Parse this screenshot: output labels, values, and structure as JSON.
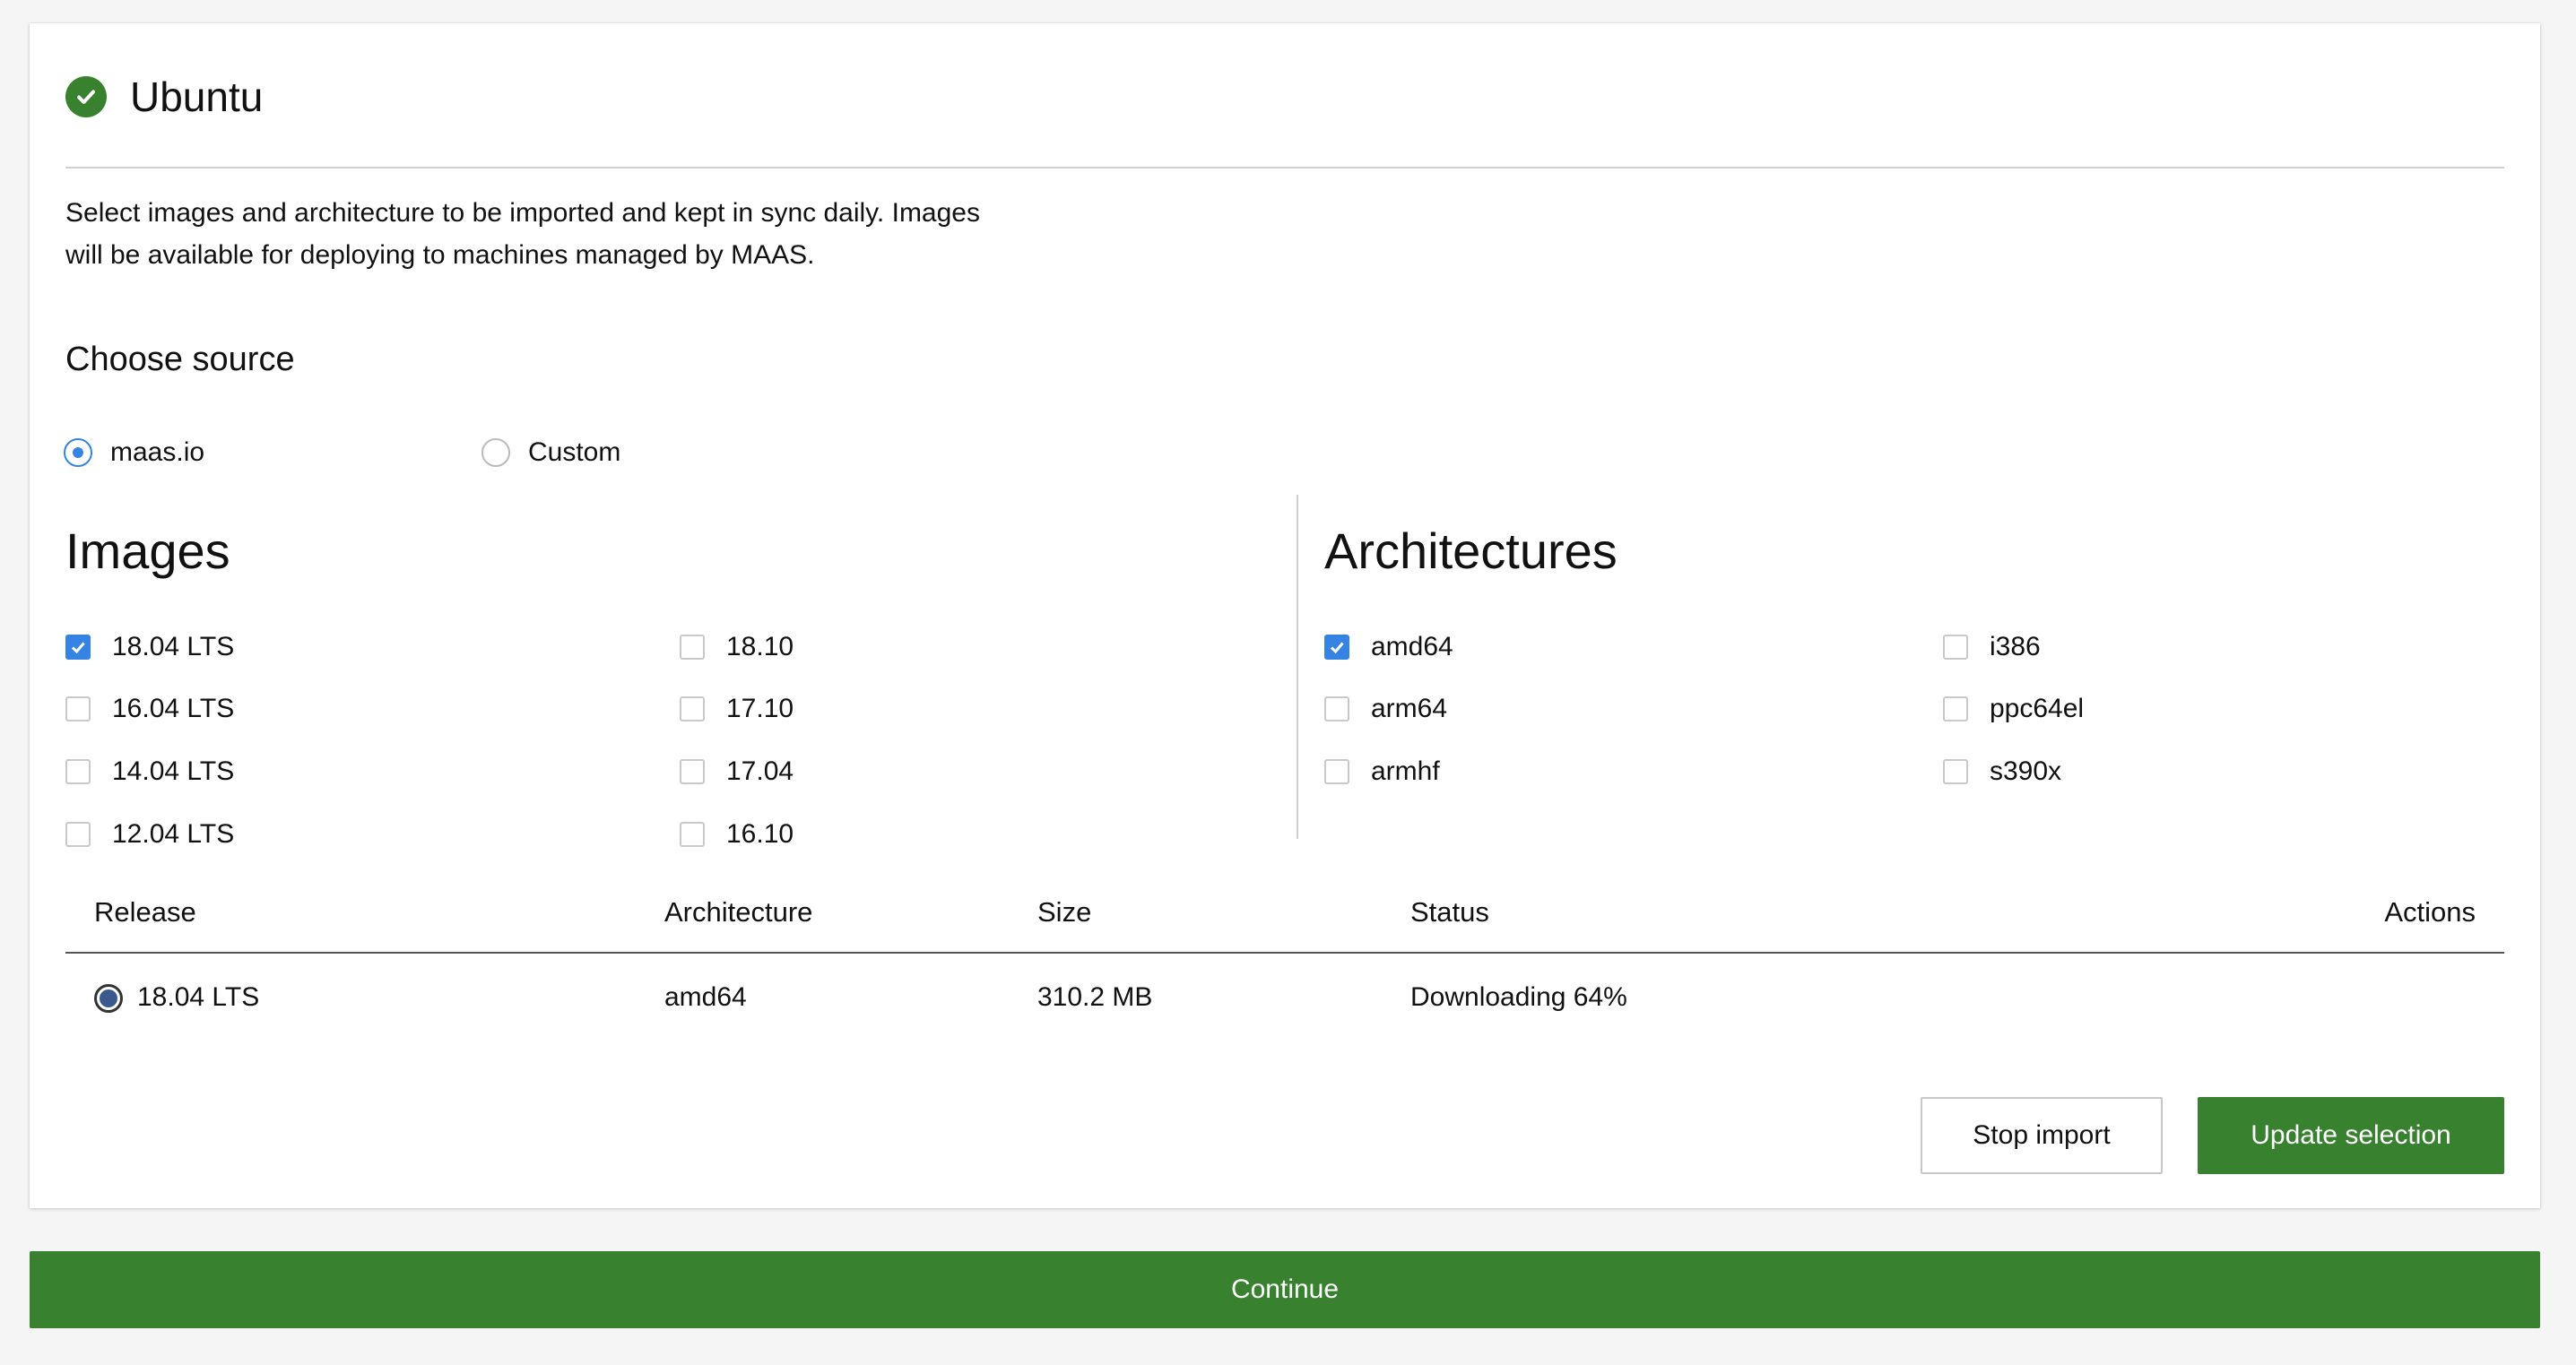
{
  "card": {
    "title": "Ubuntu",
    "intro_line1": "Select images and architecture to be imported and kept in sync daily. Images",
    "intro_line2": "will be available for deploying to machines managed by MAAS."
  },
  "source": {
    "heading": "Choose source",
    "options": [
      {
        "label": "maas.io",
        "selected": true
      },
      {
        "label": "Custom",
        "selected": false
      }
    ]
  },
  "images": {
    "heading": "Images",
    "items": [
      {
        "label": "18.04 LTS",
        "checked": true
      },
      {
        "label": "16.04 LTS",
        "checked": false
      },
      {
        "label": "14.04 LTS",
        "checked": false
      },
      {
        "label": "12.04 LTS",
        "checked": false
      },
      {
        "label": "18.10",
        "checked": false
      },
      {
        "label": "17.10",
        "checked": false
      },
      {
        "label": "17.04",
        "checked": false
      },
      {
        "label": "16.10",
        "checked": false
      }
    ]
  },
  "architectures": {
    "heading": "Architectures",
    "items": [
      {
        "label": "amd64",
        "checked": true
      },
      {
        "label": "arm64",
        "checked": false
      },
      {
        "label": "armhf",
        "checked": false
      },
      {
        "label": "i386",
        "checked": false
      },
      {
        "label": "ppc64el",
        "checked": false
      },
      {
        "label": "s390x",
        "checked": false
      }
    ]
  },
  "table": {
    "headers": {
      "release": "Release",
      "architecture": "Architecture",
      "size": "Size",
      "status": "Status",
      "actions": "Actions"
    },
    "rows": [
      {
        "release": "18.04 LTS",
        "architecture": "amd64",
        "size": "310.2 MB",
        "status": "Downloading 64%"
      }
    ]
  },
  "buttons": {
    "stop": "Stop import",
    "update": "Update selection",
    "continue": "Continue"
  },
  "colors": {
    "accent_green": "#38822f",
    "checkbox_blue": "#3584e4"
  }
}
